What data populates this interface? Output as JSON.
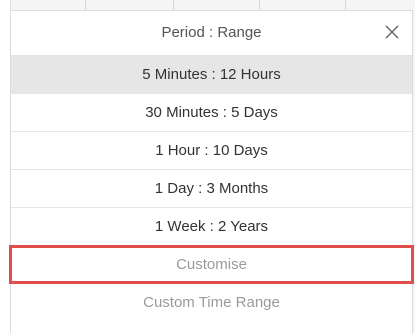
{
  "header": {
    "title": "Period : Range",
    "close_icon": "close-icon"
  },
  "options": [
    {
      "label": "5 Minutes  :  12 Hours",
      "selected": true
    },
    {
      "label": "30 Minutes  :  5 Days",
      "selected": false
    },
    {
      "label": "1 Hour  :  10 Days",
      "selected": false
    },
    {
      "label": "1 Day  :  3 Months",
      "selected": false
    },
    {
      "label": "1 Week  :  2 Years",
      "selected": false
    }
  ],
  "customise": {
    "label": "Customise",
    "highlight_color": "#e04e4e"
  },
  "custom_range": {
    "label": "Custom Time Range"
  },
  "colors": {
    "selected_row_bg": "#e6e6e6",
    "muted_text": "#9a9a9a"
  }
}
